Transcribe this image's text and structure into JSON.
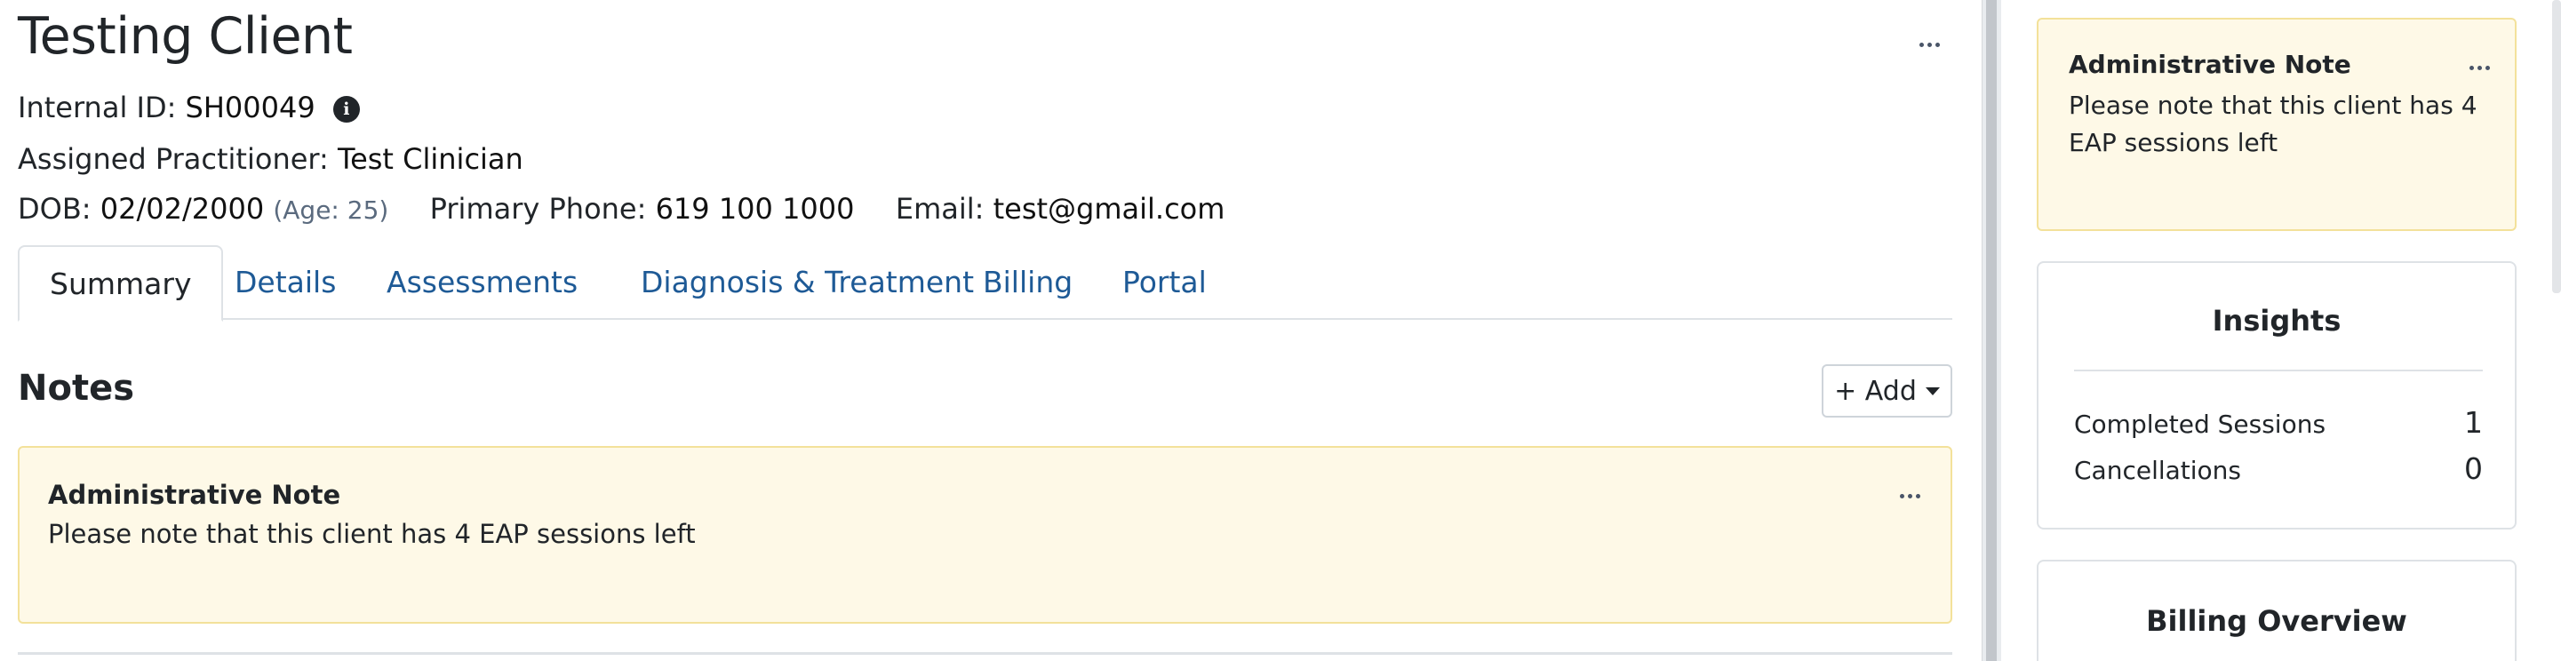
{
  "client": {
    "name": "Testing Client",
    "internal_id_label": "Internal ID:",
    "internal_id": "SH00049",
    "practitioner_label": "Assigned Practitioner:",
    "practitioner": "Test Clinician",
    "dob_label": "DOB:",
    "dob": "02/02/2000",
    "age": "(Age: 25)",
    "phone_label": "Primary Phone:",
    "phone": "619 100 1000",
    "email_label": "Email:",
    "email": "test@gmail.com"
  },
  "tabs": [
    {
      "label": "Summary",
      "active": true
    },
    {
      "label": "Details",
      "active": false
    },
    {
      "label": "Assessments",
      "active": false
    },
    {
      "label": "Diagnosis & Treatment",
      "active": false
    },
    {
      "label": "Billing",
      "active": false
    },
    {
      "label": "Portal",
      "active": false
    }
  ],
  "notes": {
    "heading": "Notes",
    "add_label": "+ Add",
    "items": [
      {
        "title": "Administrative Note",
        "text": "Please note that this client has 4 EAP sessions left"
      }
    ]
  },
  "sidebar": {
    "note": {
      "title": "Administrative Note",
      "text": "Please note that this client has 4 EAP sessions left"
    },
    "insights": {
      "title": "Insights",
      "stats": [
        {
          "label": "Completed Sessions",
          "value": "1"
        },
        {
          "label": "Cancellations",
          "value": "0"
        }
      ]
    },
    "billing": {
      "title": "Billing Overview"
    }
  },
  "icons": {
    "info": "info-circle-icon",
    "more": "more-dots-icon",
    "caret": "caret-down-icon"
  },
  "colors": {
    "link": "#1e5a96",
    "note_background": "#fef9e7",
    "note_border": "#f3e19a"
  }
}
